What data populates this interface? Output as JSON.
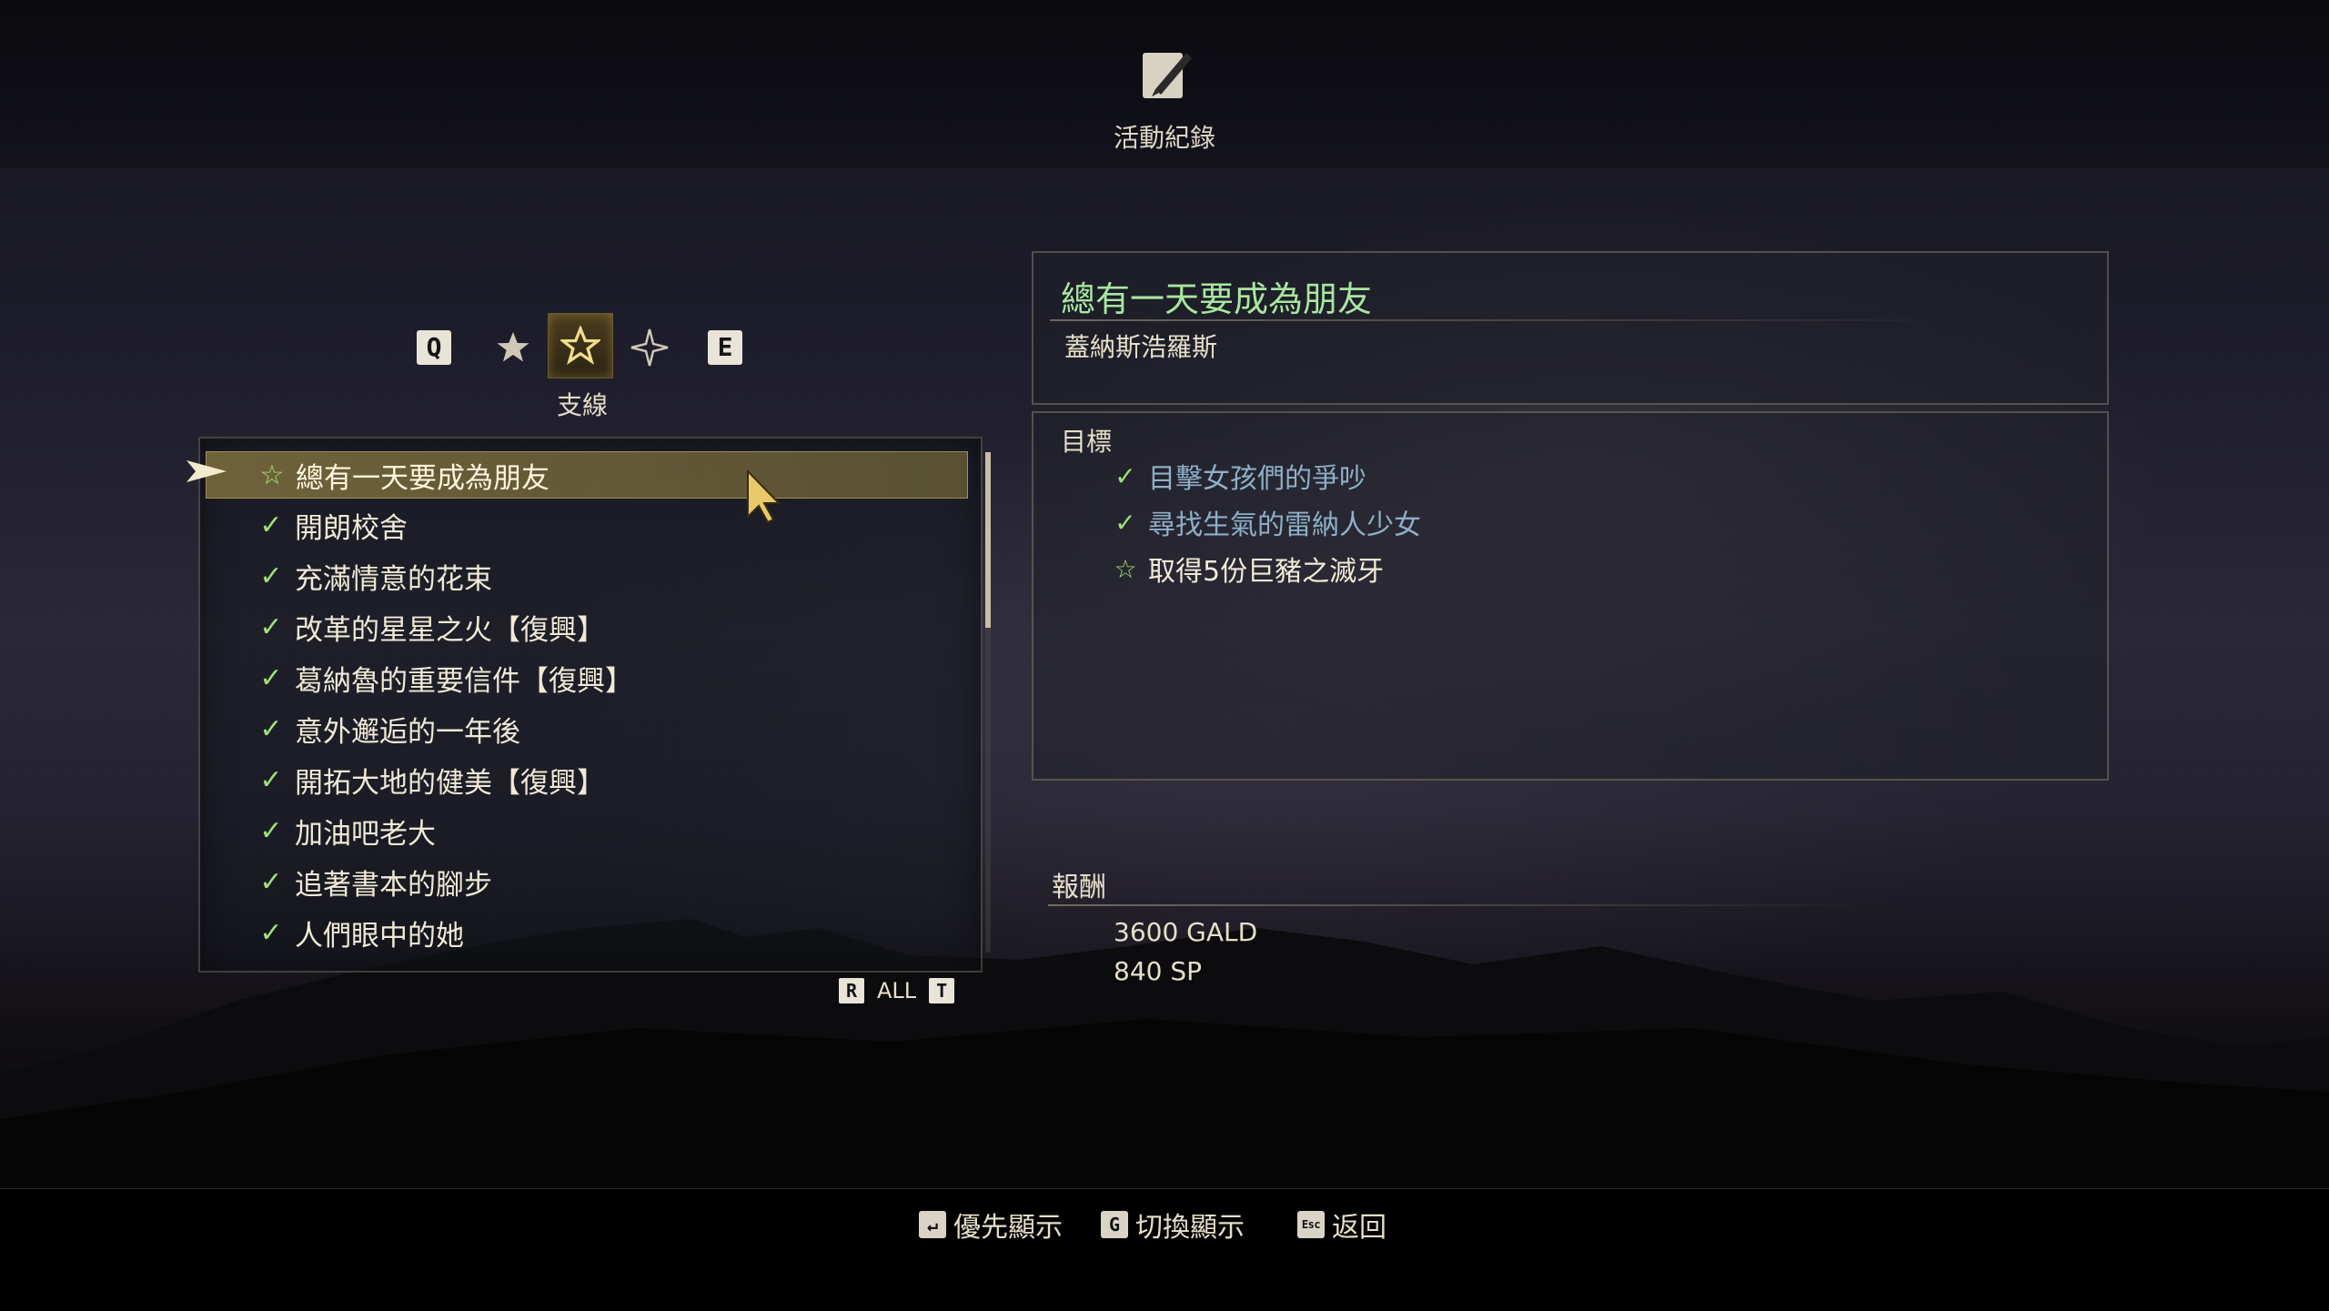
{
  "header": {
    "title": "活動紀錄",
    "icon": "quest-log-icon"
  },
  "tabs": {
    "prev_key": "Q",
    "next_key": "E",
    "items": [
      {
        "icon": "star-filled-icon",
        "active": false
      },
      {
        "icon": "star-outline-icon",
        "active": true
      },
      {
        "icon": "sparkle-icon",
        "active": false
      }
    ],
    "active_caption": "支線"
  },
  "quest_list": {
    "items": [
      {
        "label": "總有一天要成為朋友",
        "status": "current",
        "mark": "☆"
      },
      {
        "label": "開朗校舍",
        "status": "done",
        "mark": "✓"
      },
      {
        "label": "充滿情意的花束",
        "status": "done",
        "mark": "✓"
      },
      {
        "label": "改革的星星之火【復興】",
        "status": "done",
        "mark": "✓"
      },
      {
        "label": "葛納魯的重要信件【復興】",
        "status": "done",
        "mark": "✓"
      },
      {
        "label": "意外邂逅的一年後",
        "status": "done",
        "mark": "✓"
      },
      {
        "label": "開拓大地的健美【復興】",
        "status": "done",
        "mark": "✓"
      },
      {
        "label": "加油吧老大",
        "status": "done",
        "mark": "✓"
      },
      {
        "label": "追著書本的腳步",
        "status": "done",
        "mark": "✓"
      },
      {
        "label": "人們眼中的她",
        "status": "done",
        "mark": "✓"
      }
    ],
    "scroll_fraction": 0.35
  },
  "filter": {
    "left_key": "R",
    "label": "ALL",
    "right_key": "T"
  },
  "detail": {
    "title": "總有一天要成為朋友",
    "giver": "蓋納斯浩羅斯",
    "objectives_heading": "目標",
    "objectives": [
      {
        "label": "目擊女孩們的爭吵",
        "status": "done",
        "mark": "✓"
      },
      {
        "label": "尋找生氣的雷納人少女",
        "status": "done",
        "mark": "✓"
      },
      {
        "label": "取得5份巨豬之滅牙",
        "status": "current",
        "mark": "☆"
      }
    ],
    "rewards_heading": "報酬",
    "rewards": [
      "3600 GALD",
      "840 SP"
    ]
  },
  "hints": [
    {
      "key": "↵",
      "label": "優先顯示"
    },
    {
      "key": "G",
      "label": "切換顯示"
    },
    {
      "key": "Esc",
      "label": "返回"
    }
  ],
  "colors": {
    "accent_green": "#9fe07a",
    "title_green": "#a8e6a0",
    "done_blue": "#8eb0c8",
    "gold": "#e8c96a"
  }
}
